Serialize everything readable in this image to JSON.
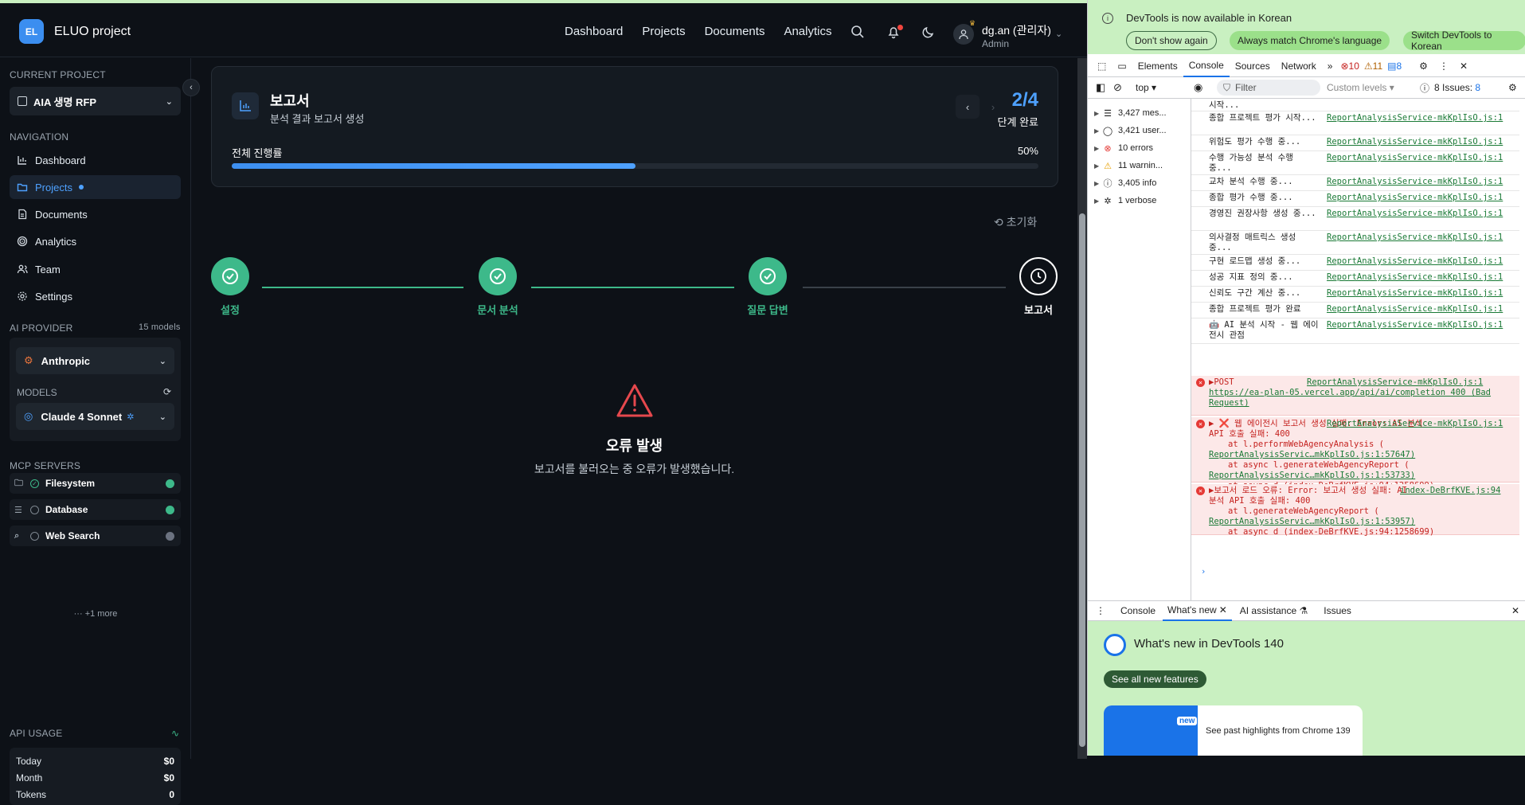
{
  "app": {
    "logo_initials": "EL",
    "name": "ELUO project"
  },
  "topnav": [
    "Dashboard",
    "Projects",
    "Documents",
    "Analytics"
  ],
  "user": {
    "name": "dg.an (관리자)",
    "role": "Admin"
  },
  "sidebar": {
    "current_project_label": "CURRENT PROJECT",
    "current_project": "AIA 생명 RFP",
    "navigation_label": "NAVIGATION",
    "nav_items": [
      {
        "label": "Dashboard",
        "icon": "dashboard-icon"
      },
      {
        "label": "Projects",
        "icon": "folder-icon",
        "active": true
      },
      {
        "label": "Documents",
        "icon": "document-icon"
      },
      {
        "label": "Analytics",
        "icon": "analytics-icon"
      },
      {
        "label": "Team",
        "icon": "team-icon"
      },
      {
        "label": "Settings",
        "icon": "gear-icon"
      }
    ],
    "ai_provider_label": "AI PROVIDER",
    "ai_provider_count": "15 models",
    "provider": "Anthropic",
    "models_label": "MODELS",
    "model": "Claude 4 Sonnet",
    "mcp_label": "MCP SERVERS",
    "mcp_servers": [
      {
        "name": "Filesystem",
        "status_color": "#3db98a"
      },
      {
        "name": "Database",
        "status_color": "#3db98a"
      },
      {
        "name": "Web Search",
        "status_color": "#6b7280"
      }
    ],
    "more_label": "+1 more",
    "api_usage_label": "API USAGE",
    "usage": [
      {
        "label": "Today",
        "value": "$0"
      },
      {
        "label": "Month",
        "value": "$0"
      },
      {
        "label": "Tokens",
        "value": "0"
      }
    ]
  },
  "report": {
    "title": "보고서",
    "subtitle": "분석 결과 보고서 생성",
    "step_count": "2/4",
    "step_done_label": "단계 완료",
    "progress_label": "전체 진행률",
    "progress_pct_text": "50%",
    "progress_fraction": 0.5,
    "reset_label": "초기화"
  },
  "steps": [
    {
      "label": "설정",
      "state": "done"
    },
    {
      "label": "문서 분석",
      "state": "done"
    },
    {
      "label": "질문 답변",
      "state": "done"
    },
    {
      "label": "보고서",
      "state": "current"
    }
  ],
  "error": {
    "title": "오류 발생",
    "message": "보고서를 불러오는 중 오류가 발생했습니다."
  },
  "colors": {
    "accent": "#4ea1ff",
    "success": "#3db98a",
    "error": "#e5484d"
  },
  "devtools": {
    "banner_text": "DevTools is now available in Korean",
    "banner_buttons": [
      "Don't show again",
      "Always match Chrome's language",
      "Switch DevTools to Korean"
    ],
    "tabs": [
      "Elements",
      "Console",
      "Sources",
      "Network"
    ],
    "error_count": "10",
    "warning_count": "11",
    "message_count": "8",
    "context": "top",
    "filter_placeholder": "Filter",
    "levels": "Custom levels",
    "issues": "8 Issues:",
    "issues_count": "8",
    "sidebar": [
      {
        "label": "3,427 mes...",
        "icon": "list-icon"
      },
      {
        "label": "3,421 user...",
        "icon": "user-icon"
      },
      {
        "label": "10 errors",
        "icon": "error-icon"
      },
      {
        "label": "11 warnin...",
        "icon": "warning-icon"
      },
      {
        "label": "3,405 info",
        "icon": "info-icon"
      },
      {
        "label": "1 verbose",
        "icon": "bug-icon"
      }
    ],
    "logs": [
      {
        "msg": "시작...",
        "src": ""
      },
      {
        "msg": "종합 프로젝트 평가 시작...",
        "src": "ReportAnalysisService-mkKplIsO.js:1"
      },
      {
        "msg": "위험도 평가 수행 중...",
        "src": "ReportAnalysisService-mkKplIsO.js:1"
      },
      {
        "msg": "수행 가능성 분석 수행 중...",
        "src": "ReportAnalysisService-mkKplIsO.js:1"
      },
      {
        "msg": "교차 분석 수행 중...",
        "src": "ReportAnalysisService-mkKplIsO.js:1"
      },
      {
        "msg": "종합 평가 수행 중...",
        "src": "ReportAnalysisService-mkKplIsO.js:1"
      },
      {
        "msg": "경영진 권장사항 생성 중...",
        "src": "ReportAnalysisService-mkKplIsO.js:1"
      },
      {
        "msg": "의사결정 매트릭스 생성 중...",
        "src": "ReportAnalysisService-mkKplIsO.js:1"
      },
      {
        "msg": "구현 로드맵 생성 중...",
        "src": "ReportAnalysisService-mkKplIsO.js:1"
      },
      {
        "msg": "성공 지표 정의 중...",
        "src": "ReportAnalysisService-mkKplIsO.js:1"
      },
      {
        "msg": "신뢰도 구간 계산 중...",
        "src": "ReportAnalysisService-mkKplIsO.js:1"
      },
      {
        "msg": "종합 프로젝트 평가 완료",
        "src": "ReportAnalysisService-mkKplIsO.js:1"
      },
      {
        "msg": "🤖 AI 분석 시작 - 웹 에이전시 관점",
        "src": "ReportAnalysisService-mkKplIsO.js:1"
      }
    ],
    "errors": [
      {
        "head": "▶POST",
        "src": "ReportAnalysisService-mkKplIsO.js:1",
        "lines": [
          "https://ea-plan-05.vercel.app/api/ai/completion 400 (Bad Request)"
        ]
      },
      {
        "head": "▶ ❌ 웹 에이전시 보고서 생성 실패: Error: AI 분석 API 호출 실패: 400",
        "src": "ReportAnalysisService-mkKplIsO.js:1",
        "lines": [
          "at l.performWebAgencyAnalysis (",
          "ReportAnalysisServic…mkKplIsO.js:1:57647)",
          "at async l.generateWebAgencyReport (",
          "ReportAnalysisServic…mkKplIsO.js:1:53733)",
          "at async d (index-DeBrfKVE.js:94:1258699)"
        ]
      },
      {
        "head": "▶보고서 로드 오류: Error: 보고서 생성 실패: AI 분석 API 호출 실패: 400",
        "src": "index-DeBrfKVE.js:94",
        "lines": [
          "at l.generateWebAgencyReport (",
          "ReportAnalysisServic…mkKplIsO.js:1:53957)",
          "at async d (index-DeBrfKVE.js:94:1258699)"
        ]
      }
    ],
    "drawer_tabs": [
      "Console",
      "What's new",
      "AI assistance",
      "Issues"
    ],
    "whats_new_title": "What's new in DevTools 140",
    "see_all": "See all new features",
    "new_badge": "new",
    "highlight_text": "See past highlights from Chrome 139"
  }
}
